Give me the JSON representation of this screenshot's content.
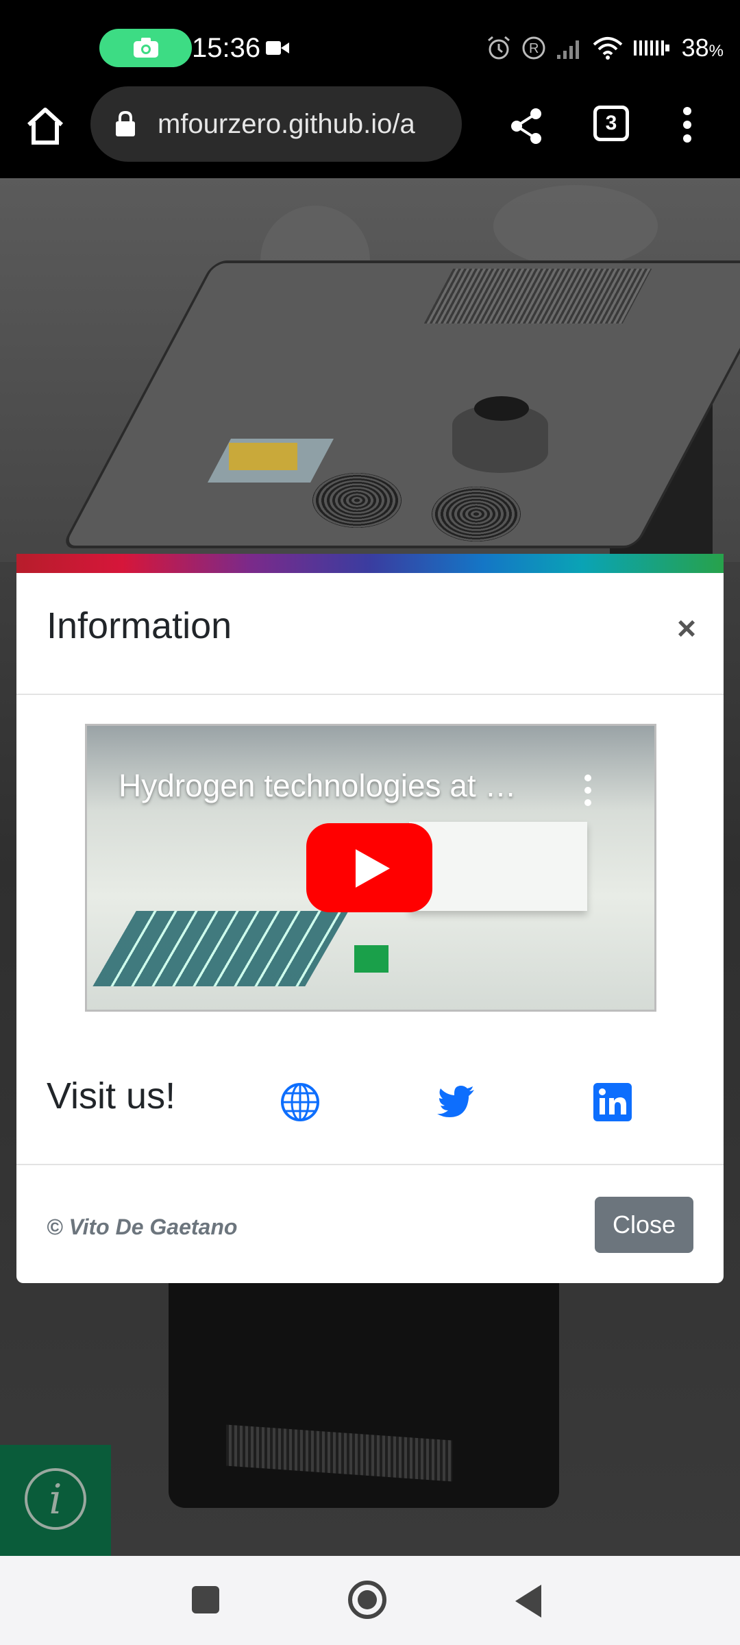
{
  "status_bar": {
    "time": "15:36",
    "battery": "38",
    "battery_unit": "%"
  },
  "browser": {
    "url": "mfourzero.github.io/a",
    "tab_count": "3"
  },
  "modal": {
    "title": "Information",
    "close_x": "×",
    "video_title": "Hydrogen technologies at …",
    "visit_label": "Visit us!",
    "copyright": "© Vito De Gaetano",
    "close_button": "Close"
  },
  "icons": {
    "website": "globe-icon",
    "twitter": "twitter-icon",
    "linkedin": "linkedin-icon",
    "info": "info-icon"
  },
  "info_fab": {
    "glyph": "i"
  },
  "colors": {
    "accent_blue": "#0d6efd",
    "secondary_gray": "#6c757d",
    "fab_green": "#0a5c3a",
    "youtube_red": "#ff0000"
  }
}
